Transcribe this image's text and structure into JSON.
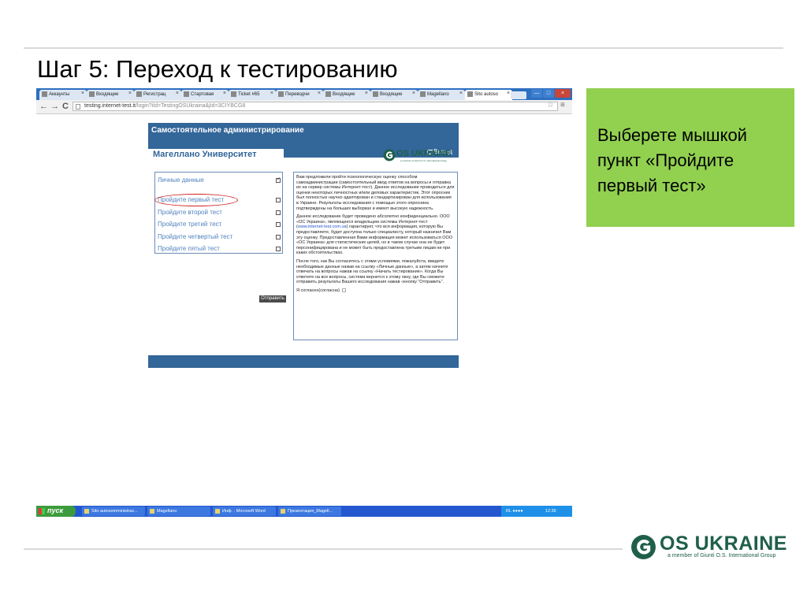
{
  "slide": {
    "title": "Шаг 5: Переход к тестированию",
    "note": "Выберете мышкой пункт «Пройдите первый тест»",
    "logo": {
      "name": "OS UKRAINE",
      "tagline": "a member of Giunti O.S. International Group"
    }
  },
  "browser": {
    "tabs": [
      {
        "label": "Аккаунты",
        "close": "×"
      },
      {
        "label": "Входящие",
        "close": "×"
      },
      {
        "label": "Регистрац",
        "close": "×"
      },
      {
        "label": "Стартовая",
        "close": "×"
      },
      {
        "label": "Ticket #65",
        "close": "×"
      },
      {
        "label": "Переводчи",
        "close": "×"
      },
      {
        "label": "Входящие",
        "close": "×"
      },
      {
        "label": "Входящие",
        "close": "×"
      },
      {
        "label": "Magellano",
        "close": "×"
      },
      {
        "label": "Sito autoso",
        "close": "×"
      }
    ],
    "url_host": "testing.internet-test.it",
    "url_path": "/login?iId=TestingOSUkraina&jId=3CIYBCG8",
    "back": "←",
    "forward": "→",
    "reload": "C",
    "star": "☆",
    "menu": "≡",
    "window_controls": {
      "minimize": "—",
      "maximize": "□",
      "close": "×"
    }
  },
  "app": {
    "title": "Самостоятельное администрирование",
    "logout": "Выход",
    "university": "Магеллано Университет",
    "logo": {
      "name": "OS UKRAINE",
      "tagline": "a member of Giunti O.S. International Group"
    },
    "tests": [
      {
        "label": "Личные данные",
        "checked": true
      },
      {
        "label": "Пройдите первый тест",
        "checked": false
      },
      {
        "label": "Пройдите второй тест",
        "checked": false
      },
      {
        "label": "Пройдите третий тест",
        "checked": false
      },
      {
        "label": "Пройдите четвертый тест",
        "checked": false
      },
      {
        "label": "Пройдите пятый тест",
        "checked": false
      }
    ],
    "submit": "Отправить",
    "info": {
      "p1": "Вам предложили пройти психологическую оценку способом самоадминистрации (самостоятельный ввод ответов на вопросы и отправка их на сервер системы Интернет-тест). Данное исследование проводиться для оценки некоторых личностных и/или деловых характеристик. Этот опросник был полностью научно адаптирован и стандартизирован для использования в Украине. Результаты исследования с помощью этого опросника подтверждены на больших выборках и имеют высокую надежность.",
      "p2a": "Данное исследование будет проведено абсолютно конфиденциально. ООО «ОС Украина», являющееся владельцем системы Интернет-тест (",
      "p2_link": "www.internet-test.com.ua",
      "p2b": ") гарантирует, что вся информация, которую Вы предоставляете, будет доступна только специалисту, который назначил Вам эту оценку. Предоставленная Вами информация может использоваться ООО «ОС Украина» для статистических целей, но в таком случае она не будет персонифицирована и не может быть предоставлена третьим лицам ни при каких обстоятельствах.",
      "p3": "После того, как Вы согласитесь с этими условиями, пожалуйста, введите необходимые данные нажав на ссылку «Личные данные», а затем начните отвечать на вопросы нажав на ссылку «Начать тестирование». Когда Вы ответите на все вопросы, система вернется к этому окну, где Вы сможете отправить результаты Вашего исследования нажав «кнопку \"Отправить\".",
      "agree": "Я согласен(согласна)"
    }
  },
  "taskbar": {
    "start": "пуск",
    "tasks": [
      "Sito autosomministraz...",
      "Magellano",
      "Инф. - Microsoft Word",
      "Презентация_Magell..."
    ],
    "lang": "RL",
    "time": "12:36"
  },
  "colors": {
    "note_bg": "#92d050",
    "app_header": "#336699",
    "link": "#4f82bd",
    "logo_green": "#1f5f49",
    "taskbar": "#2457cf"
  }
}
